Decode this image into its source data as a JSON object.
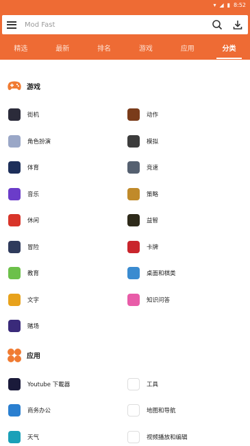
{
  "status_bar": {
    "time": "8:52"
  },
  "search": {
    "placeholder": "Mod Fast"
  },
  "tabs": [
    {
      "label": "精选"
    },
    {
      "label": "最新"
    },
    {
      "label": "排名"
    },
    {
      "label": "游戏"
    },
    {
      "label": "应用"
    },
    {
      "label": "分类",
      "active": true
    }
  ],
  "sections": {
    "games": {
      "title": "游戏",
      "icon": "game-controller-icon",
      "items": [
        {
          "label": "街机",
          "icon": "arcade-icon",
          "color": "#2b2b3a"
        },
        {
          "label": "动作",
          "icon": "action-icon",
          "color": "#7a3b1a"
        },
        {
          "label": "角色扮演",
          "icon": "roleplay-icon",
          "color": "#9aa7c7"
        },
        {
          "label": "模拟",
          "icon": "simulation-icon",
          "color": "#3c3c3c"
        },
        {
          "label": "体育",
          "icon": "sports-icon",
          "color": "#1d2f5a"
        },
        {
          "label": "竞速",
          "icon": "racing-icon",
          "color": "#556070"
        },
        {
          "label": "音乐",
          "icon": "music-icon",
          "color": "#6b3cc9"
        },
        {
          "label": "策略",
          "icon": "strategy-icon",
          "color": "#c08a2a"
        },
        {
          "label": "休闲",
          "icon": "casual-icon",
          "color": "#d8352a"
        },
        {
          "label": "益智",
          "icon": "puzzle-icon",
          "color": "#2e2a1a"
        },
        {
          "label": "冒险",
          "icon": "adventure-icon",
          "color": "#2f3b5c"
        },
        {
          "label": "卡牌",
          "icon": "card-icon",
          "color": "#c9252c"
        },
        {
          "label": "教育",
          "icon": "education-icon",
          "color": "#6cc04a"
        },
        {
          "label": "桌面和棋类",
          "icon": "board-icon",
          "color": "#3a8bd0"
        },
        {
          "label": "文字",
          "icon": "word-icon",
          "color": "#e8a21c"
        },
        {
          "label": "知识问答",
          "icon": "trivia-icon",
          "color": "#e85ca8"
        },
        {
          "label": "赌场",
          "icon": "casino-icon",
          "color": "#3a2a7a"
        }
      ]
    },
    "apps": {
      "title": "应用",
      "icon": "apps-clover-icon",
      "items": [
        {
          "label": "Youtube 下載器",
          "icon": "youtube-downloader-icon",
          "color": "#1a1a3a"
        },
        {
          "label": "工具",
          "icon": "google-icon",
          "color": "#ffffff"
        },
        {
          "label": "商务办公",
          "icon": "office-icon",
          "color": "#2a7fd0"
        },
        {
          "label": "地图和导航",
          "icon": "maps-icon",
          "color": "#ffffff"
        },
        {
          "label": "天气",
          "icon": "weather-icon",
          "color": "#1aa0b8"
        },
        {
          "label": "视频播放和编辑",
          "icon": "vlc-icon",
          "color": "#ffffff"
        }
      ]
    }
  },
  "colors": {
    "accent": "#ee6b34",
    "apps_icon": "#f07b32"
  }
}
